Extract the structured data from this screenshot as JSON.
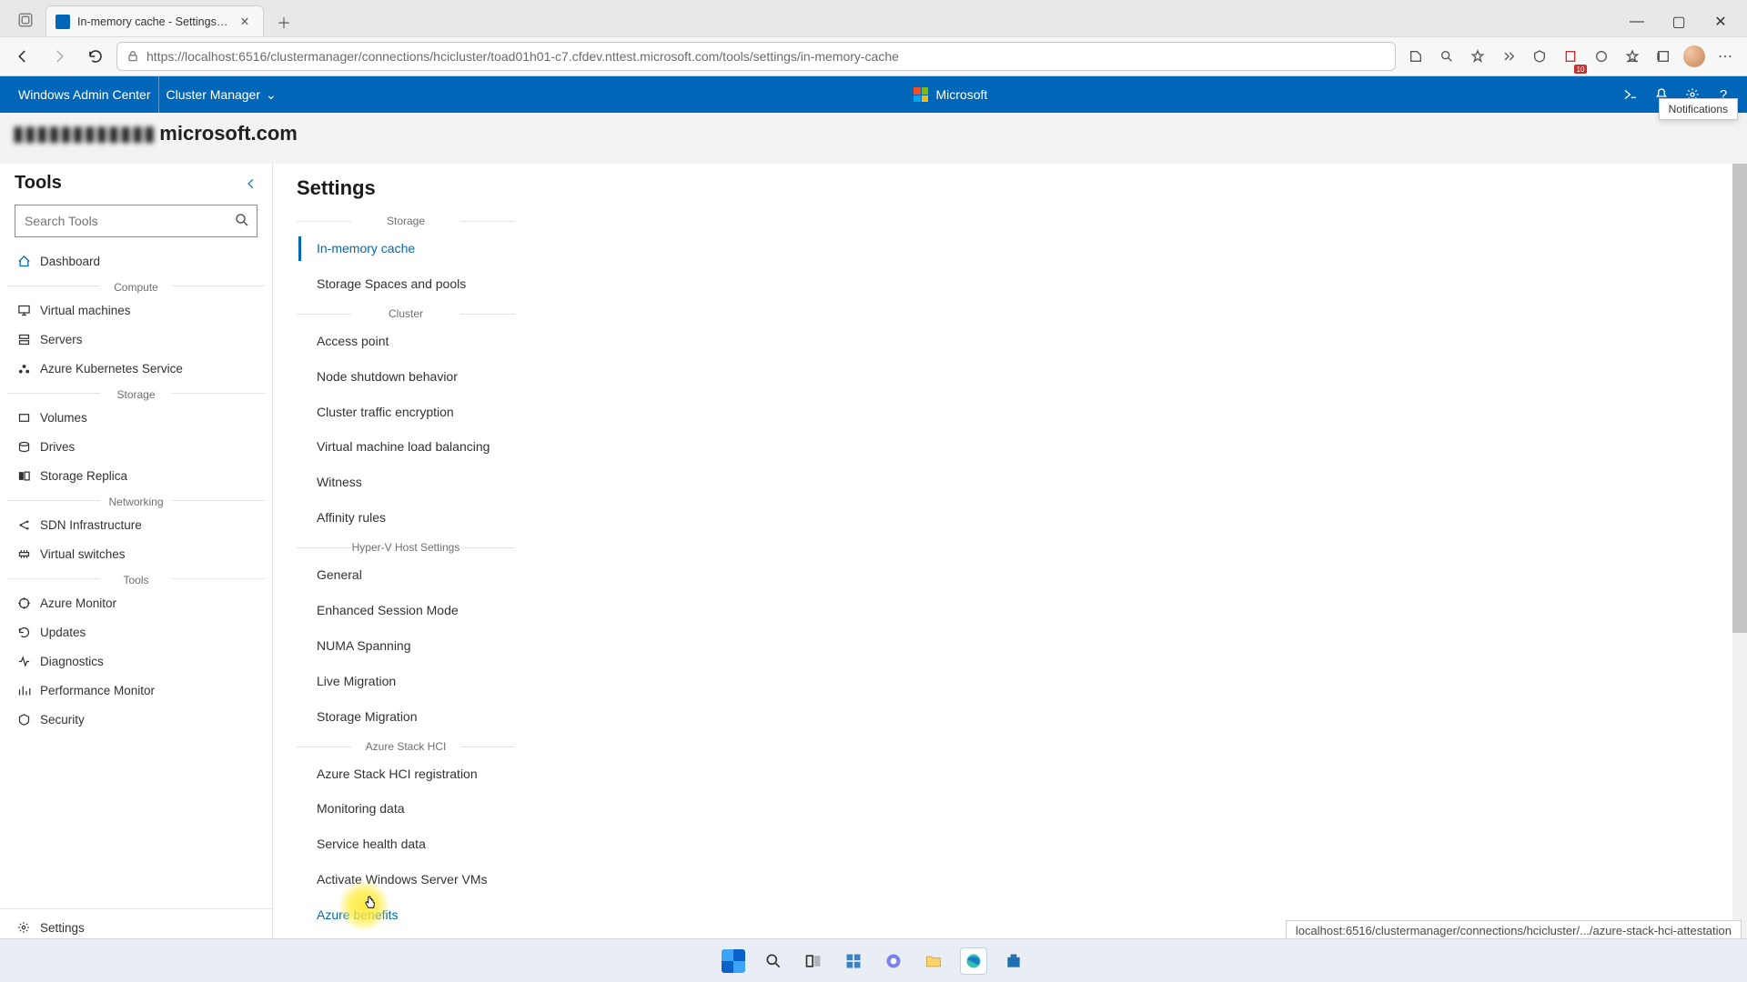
{
  "browser": {
    "tab_title": "In-memory cache - Settings - Clu",
    "url": "https://localhost:6516/clustermanager/connections/hcicluster/toad01h01-c7.cfdev.nttest.microsoft.com/tools/settings/in-memory-cache"
  },
  "wac_header": {
    "product": "Windows Admin Center",
    "context": "Cluster Manager",
    "brand": "Microsoft",
    "tooltip": "Notifications"
  },
  "host_blur": "▮▮▮▮▮▮▮▮▮▮▮▮",
  "host_suffix": "microsoft.com",
  "sidebar": {
    "title": "Tools",
    "search_placeholder": "Search Tools",
    "groups": [
      {
        "label": "",
        "items": [
          {
            "name": "dashboard",
            "label": "Dashboard"
          }
        ]
      },
      {
        "label": "Compute",
        "items": [
          {
            "name": "virtual-machines",
            "label": "Virtual machines"
          },
          {
            "name": "servers",
            "label": "Servers"
          },
          {
            "name": "aks",
            "label": "Azure Kubernetes Service"
          }
        ]
      },
      {
        "label": "Storage",
        "items": [
          {
            "name": "volumes",
            "label": "Volumes"
          },
          {
            "name": "drives",
            "label": "Drives"
          },
          {
            "name": "storage-replica",
            "label": "Storage Replica"
          }
        ]
      },
      {
        "label": "Networking",
        "items": [
          {
            "name": "sdn",
            "label": "SDN Infrastructure"
          },
          {
            "name": "vswitches",
            "label": "Virtual switches"
          }
        ]
      },
      {
        "label": "Tools",
        "items": [
          {
            "name": "azure-monitor",
            "label": "Azure Monitor"
          },
          {
            "name": "updates",
            "label": "Updates"
          },
          {
            "name": "diagnostics",
            "label": "Diagnostics"
          },
          {
            "name": "perfmon",
            "label": "Performance Monitor"
          },
          {
            "name": "security",
            "label": "Security"
          }
        ]
      }
    ],
    "bottom_item": {
      "name": "settings",
      "label": "Settings"
    }
  },
  "settings": {
    "title": "Settings",
    "sections": [
      {
        "label": "Storage",
        "items": [
          {
            "label": "In-memory cache",
            "active": true
          },
          {
            "label": "Storage Spaces and pools"
          }
        ]
      },
      {
        "label": "Cluster",
        "items": [
          {
            "label": "Access point"
          },
          {
            "label": "Node shutdown behavior"
          },
          {
            "label": "Cluster traffic encryption"
          },
          {
            "label": "Virtual machine load balancing"
          },
          {
            "label": "Witness"
          },
          {
            "label": "Affinity rules"
          }
        ]
      },
      {
        "label": "Hyper-V Host Settings",
        "items": [
          {
            "label": "General"
          },
          {
            "label": "Enhanced Session Mode"
          },
          {
            "label": "NUMA Spanning"
          },
          {
            "label": "Live Migration"
          },
          {
            "label": "Storage Migration"
          }
        ]
      },
      {
        "label": "Azure Stack HCI",
        "items": [
          {
            "label": "Azure Stack HCI registration"
          },
          {
            "label": "Monitoring data"
          },
          {
            "label": "Service health data"
          },
          {
            "label": "Activate Windows Server VMs"
          },
          {
            "label": "Azure benefits",
            "hover": true
          }
        ]
      }
    ]
  },
  "status_bar": "localhost:6516/clustermanager/connections/hcicluster/.../azure-stack-hci-attestation",
  "colors": {
    "accent": "#0067b8"
  }
}
